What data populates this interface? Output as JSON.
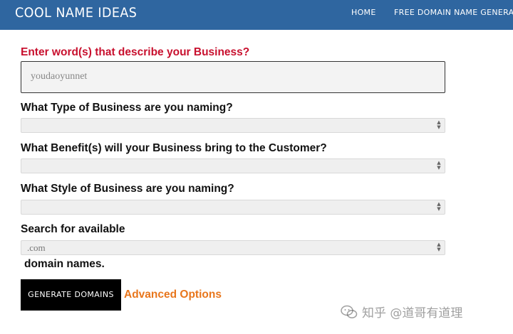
{
  "header": {
    "brand": "COOL NAME IDEAS",
    "nav": {
      "home": "HOME",
      "generators": "FREE DOMAIN NAME GENERATORS"
    }
  },
  "form": {
    "describe_label": "Enter word(s) that describe your Business?",
    "describe_value": "youdaoyunnet",
    "type_label": "What Type of Business are you naming?",
    "type_value": "",
    "benefit_label": "What Benefit(s) will your Business bring to the Customer?",
    "benefit_value": "",
    "style_label": "What Style of Business are you naming?",
    "style_value": "",
    "search_label": "Search for available",
    "tld_value": ".com",
    "domain_suffix": "domain names.",
    "generate_label": "GENERATE DOMAINS",
    "advanced_label": "Advanced Options"
  },
  "watermark": {
    "text": "知乎 @道哥有道理",
    "icon": "wechat-icon"
  },
  "colors": {
    "header_bg": "#2f66a0",
    "accent_red": "#c8102e",
    "accent_orange": "#e8761c",
    "button_bg": "#000000"
  }
}
